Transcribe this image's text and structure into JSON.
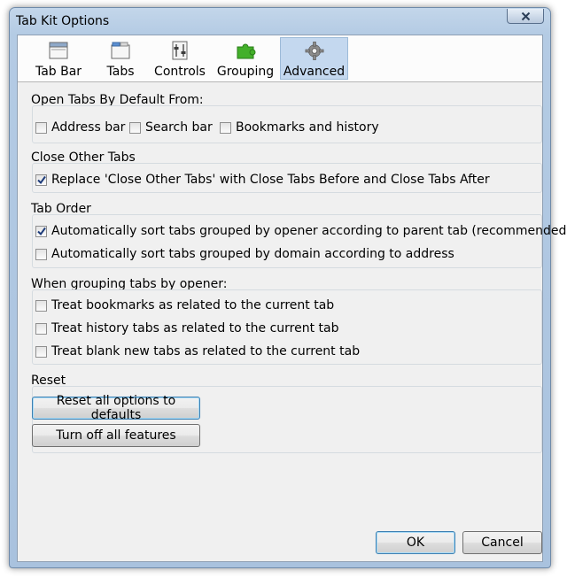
{
  "window": {
    "title": "Tab Kit Options"
  },
  "tabs": [
    {
      "label": "Tab Bar",
      "icon": "window-icon"
    },
    {
      "label": "Tabs",
      "icon": "tabs-icon"
    },
    {
      "label": "Controls",
      "icon": "controls-icon"
    },
    {
      "label": "Grouping",
      "icon": "puzzle-icon"
    },
    {
      "label": "Advanced",
      "icon": "gear-icon",
      "selected": true
    }
  ],
  "groups": {
    "open_tabs": {
      "title": "Open Tabs By Default From:",
      "options": [
        {
          "label": "Address bar",
          "checked": false
        },
        {
          "label": "Search bar",
          "checked": false
        },
        {
          "label": "Bookmarks and history",
          "checked": false
        }
      ]
    },
    "close_other": {
      "title": "Close Other Tabs",
      "options": [
        {
          "label": "Replace 'Close Other Tabs' with Close Tabs Before and Close Tabs After",
          "checked": true
        }
      ]
    },
    "tab_order": {
      "title": "Tab Order",
      "options": [
        {
          "label": "Automatically sort tabs grouped by opener according to parent tab (recommended)",
          "checked": true
        },
        {
          "label": "Automatically sort tabs grouped by domain according to address",
          "checked": false
        }
      ]
    },
    "grouping": {
      "title": "When grouping tabs by opener:",
      "options": [
        {
          "label": "Treat bookmarks as related to the current tab",
          "checked": false
        },
        {
          "label": "Treat history tabs as related to the current tab",
          "checked": false
        },
        {
          "label": "Treat blank new tabs as related to the current tab",
          "checked": false
        }
      ]
    },
    "reset": {
      "title": "Reset",
      "reset_button": "Reset all options to defaults",
      "turn_off_button": "Turn off all features"
    }
  },
  "footer": {
    "ok_label": "OK",
    "cancel_label": "Cancel"
  },
  "colors": {
    "selected_tab": "#c4d8ef",
    "frame": "#b4cbe4",
    "panel": "#f0f0f0"
  }
}
